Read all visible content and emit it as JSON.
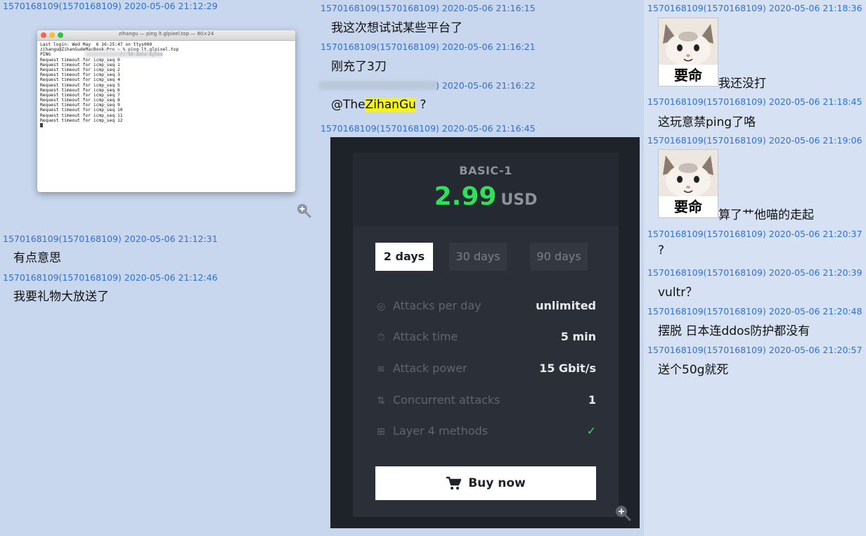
{
  "col1": {
    "m1_meta": "1570168109(1570168109) 2020-05-06 21:12:29",
    "terminal": {
      "title": "zihangu — ping lt.glpixel.top — 80×24",
      "lines": [
        "Last login: Wed May  6 16:25:47 on ttys000",
        "zihangu@ZihanGudeMacBook-Pro ~ % ping lt.glpixel.top",
        "PING                          ): 56 data bytes",
        "Request timeout for icmp_seq 0",
        "Request timeout for icmp_seq 1",
        "Request timeout for icmp_seq 2",
        "Request timeout for icmp_seq 3",
        "Request timeout for icmp_seq 4",
        "Request timeout for icmp_seq 5",
        "Request timeout for icmp_seq 6",
        "Request timeout for icmp_seq 7",
        "Request timeout for icmp_seq 8",
        "Request timeout for icmp_seq 9",
        "Request timeout for icmp_seq 10",
        "Request timeout for icmp_seq 11",
        "Request timeout for icmp_seq 12"
      ]
    },
    "m2_meta": "1570168109(1570168109) 2020-05-06 21:12:31",
    "m2_text": "有点意思",
    "m3_meta": "1570168109(1570168109) 2020-05-06 21:12:46",
    "m3_text": "我要礼物大放送了"
  },
  "col2": {
    "m1_meta": "1570168109(1570168109) 2020-05-06 21:16:15",
    "m1_text": "我这次想试试某些平台了",
    "m2_meta": "1570168109(1570168109) 2020-05-06 21:16:21",
    "m2_text": "刚充了3刀",
    "m3_meta": ") 2020-05-06 21:16:22",
    "m3_mention_prefix": "@The",
    "m3_mention_highlight": "ZihanGu",
    "m3_mention_suffix": " ?",
    "m4_meta": "1570168109(1570168109) 2020-05-06 21:16:45",
    "pricing": {
      "plan": "BASIC-1",
      "price": "2.99",
      "currency": "USD",
      "tabs": [
        "2 days",
        "30 days",
        "90 days"
      ],
      "features": [
        {
          "icon": "target-icon",
          "glyph": "◎",
          "label": "Attacks per day",
          "value": "unlimited"
        },
        {
          "icon": "stopwatch-icon",
          "glyph": "⏱",
          "label": "Attack time",
          "value": "5 min"
        },
        {
          "icon": "wifi-icon",
          "glyph": "≋",
          "label": "Attack power",
          "value": "15 Gbit/s"
        },
        {
          "icon": "sort-arrows-icon",
          "glyph": "⇅",
          "label": "Concurrent attacks",
          "value": "1"
        },
        {
          "icon": "plus-box-icon",
          "glyph": "⊞",
          "label": "Layer 4 methods",
          "value": "✓"
        }
      ],
      "buy_label": "Buy now"
    }
  },
  "col3": {
    "m1_meta": "1570168109(1570168109) 2020-05-06 21:18:36",
    "sticker_text": "要命",
    "m1_text": "我还没打",
    "m2_meta": "1570168109(1570168109) 2020-05-06 21:18:45",
    "m2_text": "这玩意禁ping了咯",
    "m3_meta": "1570168109(1570168109) 2020-05-06 21:19:06",
    "m3_text": "算了艹他喵的走起",
    "m4_meta": "1570168109(1570168109) 2020-05-06 21:20:37",
    "m4_text": "?",
    "m5_meta": "1570168109(1570168109) 2020-05-06 21:20:39",
    "m5_text": "vultr？",
    "m6_meta": "1570168109(1570168109) 2020-05-06 21:20:48",
    "m6_text": "摆脱 日本连ddos防护都没有",
    "m7_meta": "1570168109(1570168109) 2020-05-06 21:20:57",
    "m7_text": "送个50g就死"
  }
}
